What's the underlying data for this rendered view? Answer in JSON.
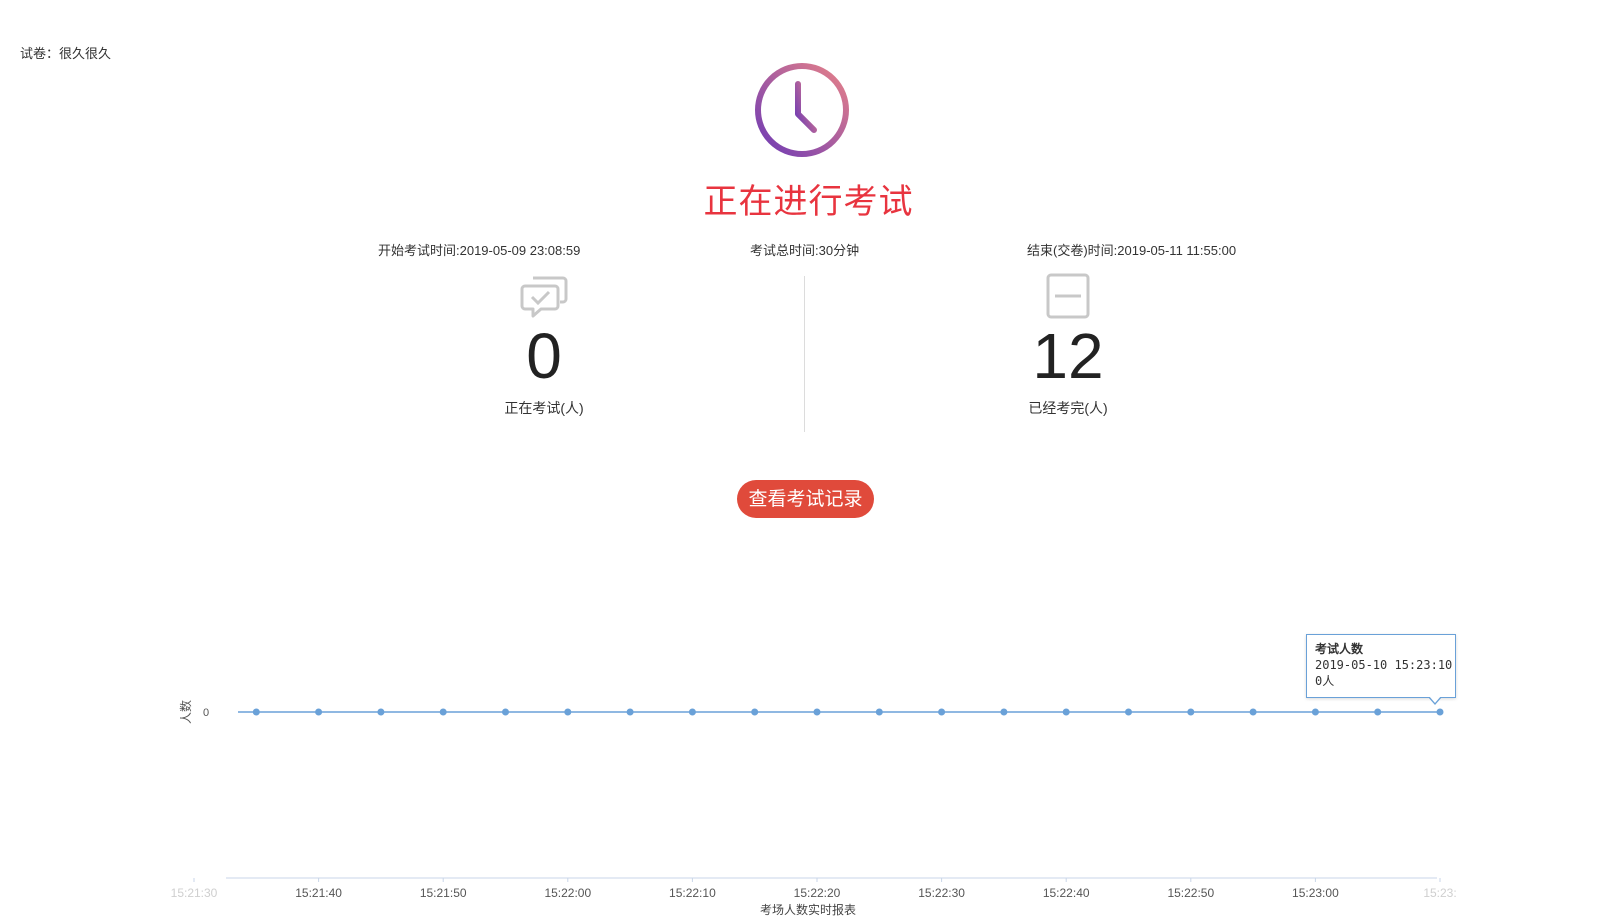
{
  "paper": {
    "label": "试卷：很久很久"
  },
  "status": {
    "title": "正在进行考试"
  },
  "info": {
    "start_time": "开始考试时间:2019-05-09 23:08:59",
    "duration": "考试总时间:30分钟",
    "end_time": "结束(交卷)时间:2019-05-11 11:55:00"
  },
  "stats": {
    "in_progress": {
      "value": "0",
      "label": "正在考试(人)",
      "icon": "chat-check-icon"
    },
    "finished": {
      "value": "12",
      "label": "已经考完(人)",
      "icon": "minus-square-icon"
    }
  },
  "actions": {
    "view_records": "查看考试记录"
  },
  "colors": {
    "status_red": "#e8343f",
    "button_red": "#e04a3b",
    "line_blue": "#6aa1d8",
    "clock_gradient_start": "#e06a8a",
    "clock_gradient_end": "#7b3fb0"
  },
  "tooltip": {
    "title": "考试人数",
    "time": "2019-05-10 15:23:10",
    "value": "0人"
  },
  "chart_data": {
    "type": "line",
    "title": "",
    "xlabel": "考场人数实时报表",
    "ylabel": "人数",
    "y_ticks": [
      "0"
    ],
    "x_ticks": [
      "15:21:30",
      "15:21:40",
      "15:21:50",
      "15:22:00",
      "15:22:10",
      "15:22:20",
      "15:22:30",
      "15:22:40",
      "15:22:50",
      "15:23:00",
      "15:23:"
    ],
    "xlim": [
      "15:21:30",
      "15:23:10"
    ],
    "series": [
      {
        "name": "考试人数",
        "x": [
          "15:21:35",
          "15:21:40",
          "15:21:45",
          "15:21:50",
          "15:21:55",
          "15:22:00",
          "15:22:05",
          "15:22:10",
          "15:22:15",
          "15:22:20",
          "15:22:25",
          "15:22:30",
          "15:22:35",
          "15:22:40",
          "15:22:45",
          "15:22:50",
          "15:22:55",
          "15:23:00",
          "15:23:05",
          "15:23:10"
        ],
        "values": [
          0,
          0,
          0,
          0,
          0,
          0,
          0,
          0,
          0,
          0,
          0,
          0,
          0,
          0,
          0,
          0,
          0,
          0,
          0,
          0
        ]
      }
    ]
  }
}
